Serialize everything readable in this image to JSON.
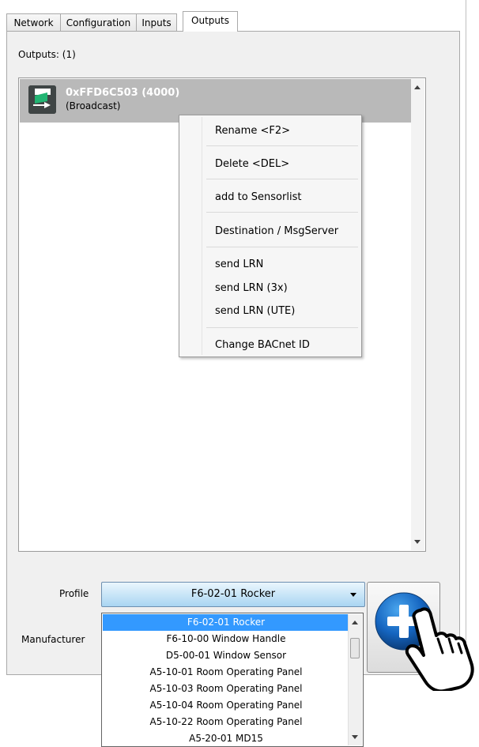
{
  "tabs": [
    {
      "label": "Network"
    },
    {
      "label": "Configuration"
    },
    {
      "label": "Inputs"
    },
    {
      "label": "Outputs"
    }
  ],
  "outputs_label": "Outputs: (1)",
  "list": {
    "items": [
      {
        "title": "0xFFD6C503 (4000)",
        "subtitle": "(Broadcast)"
      }
    ]
  },
  "context_menu": {
    "items": [
      {
        "label": "Rename <F2>"
      },
      {
        "label": "Delete <DEL>"
      },
      {
        "label": "add to Sensorlist"
      },
      {
        "label": "Destination / MsgServer"
      },
      {
        "label": "send LRN"
      },
      {
        "label": "send LRN (3x)"
      },
      {
        "label": "send LRN (UTE)"
      },
      {
        "label": "Change BACnet ID"
      }
    ]
  },
  "form": {
    "profile_label": "Profile",
    "profile_value": "F6-02-01 Rocker",
    "manufacturer_label": "Manufacturer"
  },
  "profile_options": [
    {
      "label": "F6-02-01 Rocker",
      "selected": true
    },
    {
      "label": "F6-10-00 Window Handle"
    },
    {
      "label": "D5-00-01 Window Sensor"
    },
    {
      "label": "A5-10-01 Room Operating Panel"
    },
    {
      "label": "A5-10-03 Room Operating Panel"
    },
    {
      "label": "A5-10-04 Room Operating Panel"
    },
    {
      "label": "A5-10-22 Room Operating Panel"
    },
    {
      "label": "A5-20-01 MD15"
    }
  ],
  "colors": {
    "selection": "#3399ff",
    "add_button": "#1565c0",
    "list_row": "#b9b9b9"
  }
}
